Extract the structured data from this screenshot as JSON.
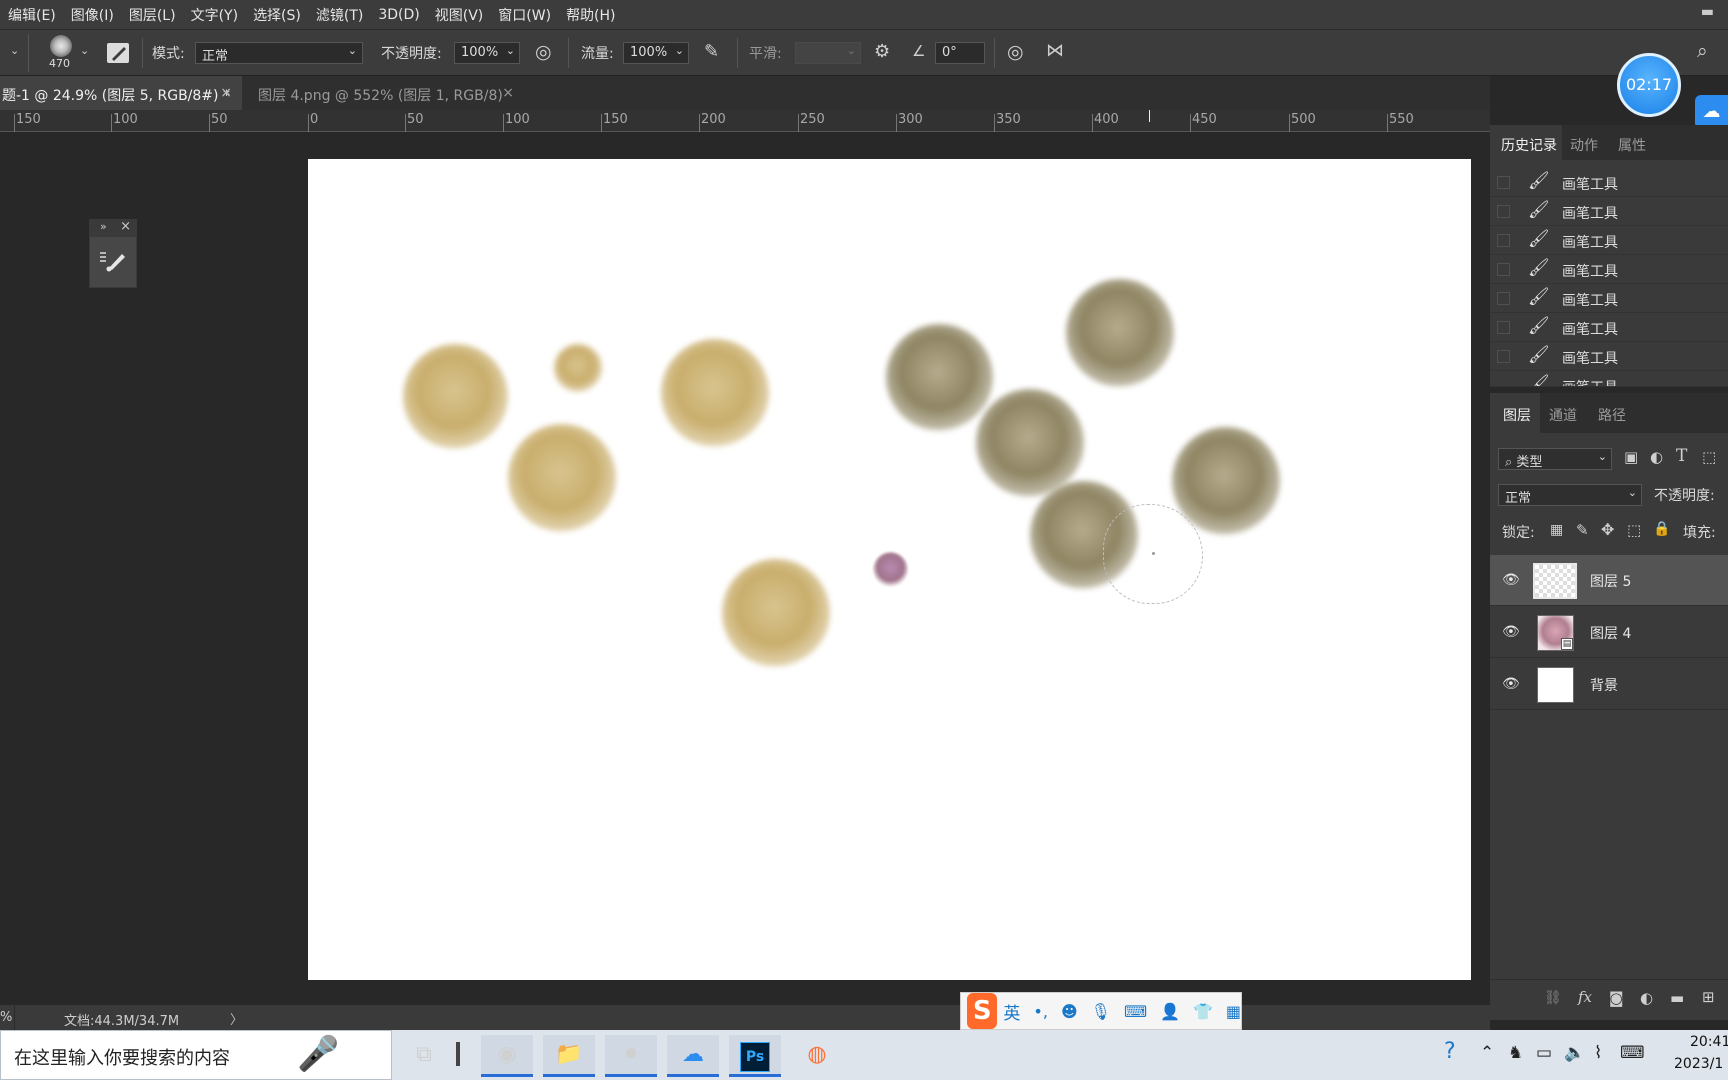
{
  "menu": {
    "items": [
      "编辑(E)",
      "图像(I)",
      "图层(L)",
      "文字(Y)",
      "选择(S)",
      "滤镜(T)",
      "3D(D)",
      "视图(V)",
      "窗口(W)",
      "帮助(H)"
    ]
  },
  "options": {
    "brush_size": "470",
    "mode_label": "模式:",
    "mode_value": "正常",
    "opacity_label": "不透明度:",
    "opacity_value": "100%",
    "flow_label": "流量:",
    "flow_value": "100%",
    "smooth_label": "平滑:",
    "smooth_value": "",
    "angle_value": "0°"
  },
  "tabs": [
    {
      "label": "题-1 @ 24.9% (图层 5, RGB/8#) *",
      "active": true
    },
    {
      "label": "图层 4.png @ 552% (图层 1, RGB/8)",
      "active": false
    }
  ],
  "ruler": {
    "ticks": [
      "150",
      "100",
      "50",
      "0",
      "50",
      "100",
      "150",
      "200",
      "250",
      "300",
      "350",
      "400",
      "450",
      "500",
      "550"
    ]
  },
  "timer": "02:17",
  "history": {
    "tabs": [
      "历史记录",
      "动作",
      "属性"
    ],
    "items": [
      "画笔工具",
      "画笔工具",
      "画笔工具",
      "画笔工具",
      "画笔工具",
      "画笔工具",
      "画笔工具",
      "画笔工具"
    ]
  },
  "layers": {
    "tabs": [
      "图层",
      "通道",
      "路径"
    ],
    "filter_label": "类型",
    "blend_mode": "正常",
    "opacity_label": "不透明度:",
    "lock_label": "锁定:",
    "fill_label": "填充:",
    "items": [
      {
        "name": "图层 5",
        "selected": true
      },
      {
        "name": "图层 4",
        "selected": false
      },
      {
        "name": "背景",
        "selected": false
      }
    ]
  },
  "status": {
    "zoom": "%",
    "doc": "文档:44.3M/34.7M"
  },
  "ime": {
    "lang": "英"
  },
  "taskbar": {
    "search_placeholder": "在这里输入你要搜索的内容",
    "time": "20:41",
    "date": "2023/1"
  },
  "colors": {
    "accent": "#1a80e6",
    "canvas": "#ffffff",
    "gold_blob": "#c9ae6c",
    "olive_blob": "#8f8563",
    "pink_blob": "#a1748c"
  }
}
